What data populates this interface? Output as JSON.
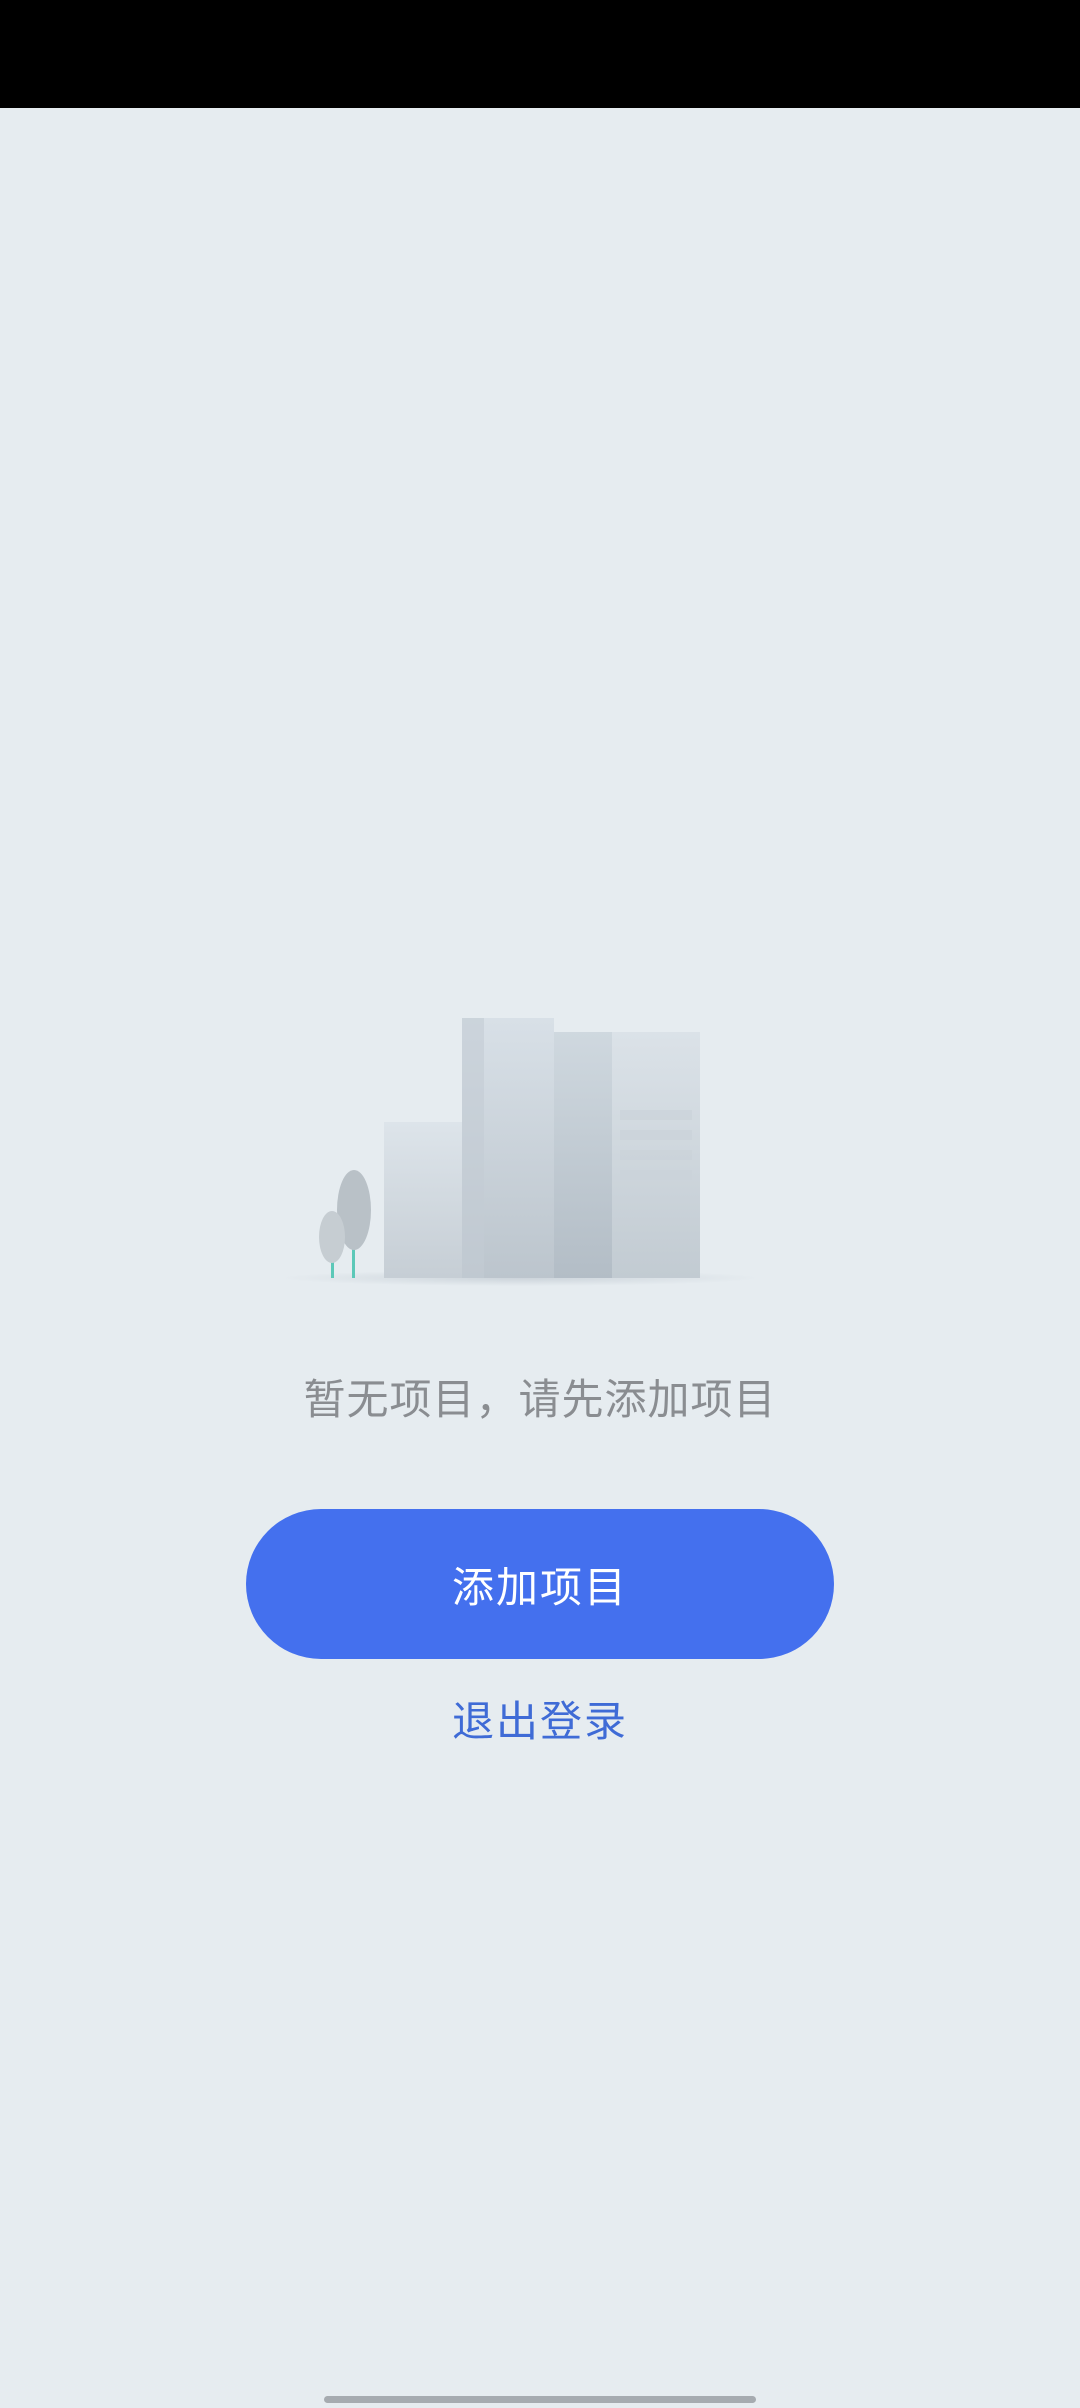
{
  "empty_state": {
    "message": "暂无项目，请先添加项目",
    "illustration_icon": "buildings-illustration"
  },
  "actions": {
    "add_project_label": "添加项目",
    "logout_label": "退出登录"
  },
  "colors": {
    "background": "#e6ecf0",
    "status_bar": "#000000",
    "primary": "#4470ee",
    "link": "#3f6bd6",
    "message_text": "#8a8d91"
  }
}
